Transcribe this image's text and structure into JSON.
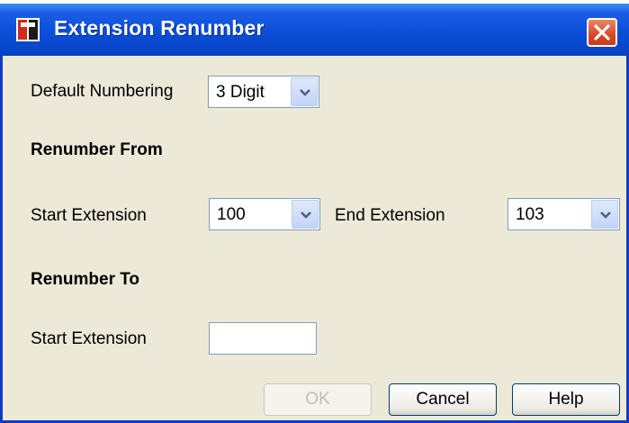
{
  "window": {
    "title": "Extension Renumber"
  },
  "default_numbering": {
    "label": "Default Numbering",
    "value": "3 Digit"
  },
  "renumber_from": {
    "heading": "Renumber From",
    "start_label": "Start Extension",
    "start_value": "100",
    "end_label": "End Extension",
    "end_value": "103"
  },
  "renumber_to": {
    "heading": "Renumber To",
    "start_label": "Start Extension",
    "start_value": ""
  },
  "buttons": {
    "ok": "OK",
    "cancel": "Cancel",
    "help": "Help"
  },
  "colors": {
    "titlebar": "#0a4ed8",
    "dialog_bg": "#ece9d8",
    "close": "#d64a26"
  }
}
